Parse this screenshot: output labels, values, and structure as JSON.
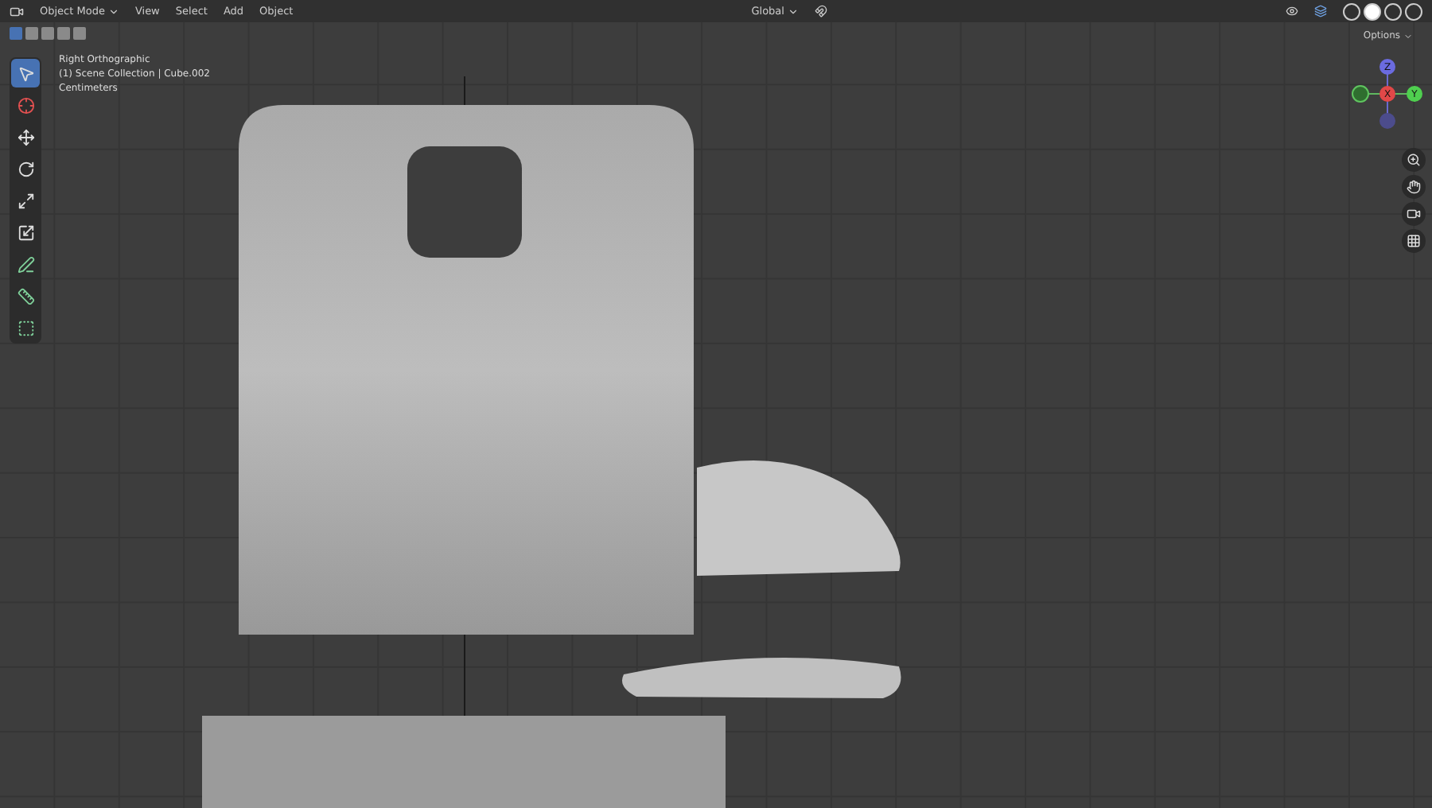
{
  "header": {
    "mode": "Object Mode",
    "menus": [
      "View",
      "Select",
      "Add",
      "Object"
    ],
    "orientation": "Global"
  },
  "select_modes": [
    {
      "selected": true
    },
    {
      "selected": false
    },
    {
      "selected": false
    },
    {
      "selected": false
    },
    {
      "selected": false
    }
  ],
  "viewport_info": [
    "Right Orthographic",
    "(1) Scene Collection | Cube.002",
    "Centimeters"
  ],
  "options": "Options",
  "gizmo": {
    "z": "Z",
    "x": "X",
    "y": "Y"
  },
  "tools": [
    {
      "kind": "select",
      "selected": true
    },
    {
      "kind": "cursor",
      "selected": false
    },
    {
      "kind": "move",
      "selected": false
    },
    {
      "kind": "rotate",
      "selected": false
    },
    {
      "kind": "scale",
      "selected": false
    },
    {
      "kind": "transform",
      "selected": false
    },
    {
      "kind": "annotate",
      "selected": false
    },
    {
      "kind": "measure",
      "selected": false
    },
    {
      "kind": "add",
      "selected": false
    }
  ],
  "shading": [
    {
      "selected": false
    },
    {
      "selected": true
    },
    {
      "selected": false
    },
    {
      "selected": false
    }
  ]
}
